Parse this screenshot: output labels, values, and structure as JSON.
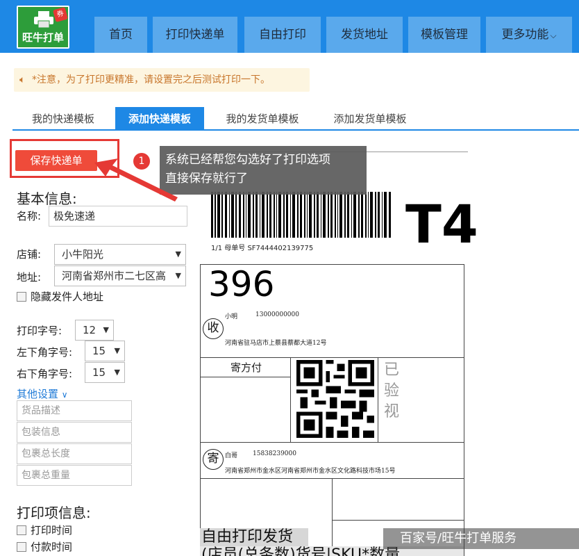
{
  "app": {
    "logo_text": "旺牛打单",
    "logo_badge": "券"
  },
  "nav": {
    "items": [
      "首页",
      "打印快递单",
      "自由打印",
      "发货地址",
      "模板管理",
      "更多功能"
    ]
  },
  "notice": {
    "text": "*注意，为了打印更精准，请设置完之后测试打印一下。"
  },
  "tabs": [
    "我的快递模板",
    "添加快递模板",
    "我的发货单模板",
    "添加发货单模板"
  ],
  "active_tab": "添加快递模板",
  "form": {
    "save_label": "保存快递单",
    "basic_title": "基本信息:",
    "name_label": "名称:",
    "name_value": "极免速递",
    "shop_label": "店铺:",
    "shop_value": "小牛阳光",
    "address_label": "地址:",
    "address_value": "河南省郑州市二七区高",
    "hide_sender_label": "隐藏发件人地址",
    "font_size_label": "打印字号:",
    "font_size_value": "12",
    "bottom_left_label": "左下角字号:",
    "bottom_left_value": "15",
    "bottom_right_label": "右下角字号:",
    "bottom_right_value": "15",
    "other_settings_label": "其他设置",
    "placeholders": [
      "货品描述",
      "包装信息",
      "包裹总长度",
      "包裹总重量"
    ],
    "print_items_title": "打印项信息:",
    "print_items": [
      "打印时间",
      "付款时间"
    ]
  },
  "tooltip": {
    "step": "1",
    "line1": "系统已经帮您勾选好了打印选项",
    "line2": "直接保存就行了"
  },
  "waybill": {
    "number_line": "1/1  母单号  SF7444402139775",
    "route_code": "T4",
    "sort_code": "396",
    "receiver_char": "收",
    "receiver_name": "小明",
    "receiver_phone": "13000000000",
    "receiver_address": "河南省驻马店市上蔡县蔡都大道12号",
    "pay_label": "寄方付",
    "verify_text": "已验视",
    "sender_char": "寄",
    "sender_name": "白哥",
    "sender_phone": "15838239000",
    "sender_address": "河南省郑州市金水区河南省郑州市金水区文化路科技市场15号"
  },
  "bottom": {
    "strip_text": "自由打印发货",
    "strip2_text": "(店员(总条数)货号|SKU*数量",
    "watermark": "百家号/旺牛打单服务"
  },
  "colors": {
    "nav_bg": "#1e88e5",
    "nav_item_bg": "#5aa9ec",
    "accent_red": "#e53935",
    "logo_green": "#2d9d3a",
    "notice_bg": "#fdf5e0",
    "notice_text": "#c8762c"
  }
}
